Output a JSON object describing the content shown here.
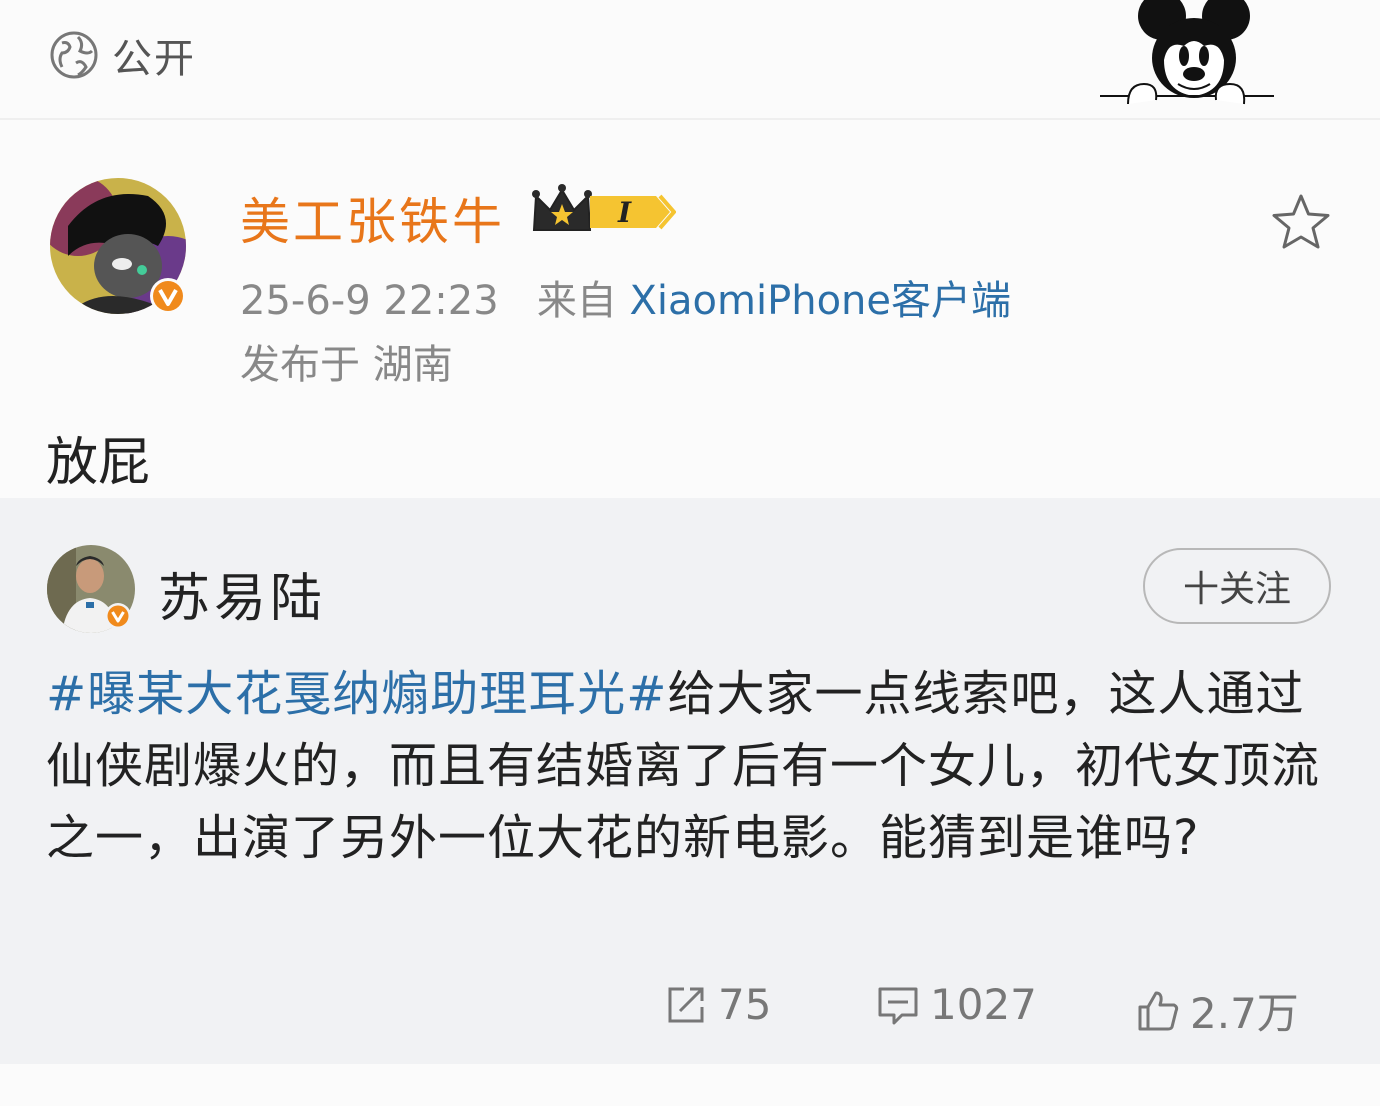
{
  "header": {
    "visibility_label": "公开",
    "visibility_icon": "globe-icon",
    "decoration_icon": "mickey-mouse-icon"
  },
  "post": {
    "author": "美工张铁牛",
    "author_color": "#e8761a",
    "badge_level": "I",
    "timestamp": "25-6-9 22:23",
    "source_prefix": "来自",
    "source": "XiaomiPhone客户端",
    "location": "发布于 湖南",
    "comment": "放屁"
  },
  "repost": {
    "author": "苏易陆",
    "follow_label": "十关注",
    "hashtag": "#曝某大花戛纳煽助理耳光#",
    "text": "给大家一点线索吧，这人通过仙侠剧爆火的，而且有结婚离了后有一个女儿，初代女顶流之一，出演了另外一位大花的新电影。能猜到是谁吗?",
    "link_color": "#2c6fa8",
    "repost_count": "75",
    "comment_count": "1027",
    "like_count": "2.7万"
  }
}
